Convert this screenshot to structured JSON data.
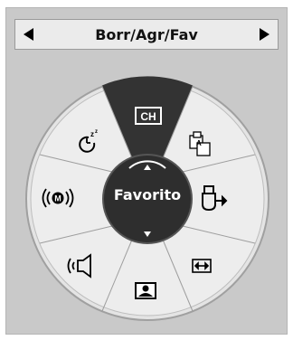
{
  "header": {
    "title": "Borr/Agr/Fav"
  },
  "center": {
    "label": "Favorito"
  },
  "wheel_items": [
    {
      "name": "channel",
      "label": "CH",
      "icon": "channel-icon",
      "selected": true
    },
    {
      "name": "pip-swap",
      "label": "A B",
      "icon": "picture-swap-icon"
    },
    {
      "name": "input",
      "icon": "input-source-icon"
    },
    {
      "name": "aspect-ratio",
      "icon": "aspect-ratio-icon"
    },
    {
      "name": "picture-mode",
      "icon": "picture-mode-icon"
    },
    {
      "name": "sound-mode",
      "icon": "sound-mode-icon"
    },
    {
      "name": "surround",
      "label": "M",
      "icon": "surround-sound-icon"
    },
    {
      "name": "sleep-timer",
      "label": "zz",
      "icon": "sleep-timer-icon"
    }
  ],
  "colors": {
    "panel": "#c9c9c9",
    "wheel": "#e6e6e6",
    "selected_segment": "#333333",
    "center": "#2e2e2e"
  }
}
